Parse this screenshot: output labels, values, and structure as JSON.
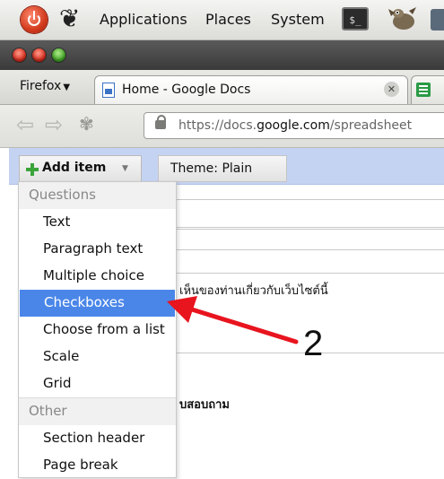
{
  "panel": {
    "menus": [
      "Applications",
      "Places",
      "System"
    ],
    "terminal_text": "$_"
  },
  "browser": {
    "menu_label": "Firefox",
    "tab_title": "Home - Google Docs",
    "url_prefix": "https://docs.",
    "url_domain": "google.com",
    "url_suffix": "/spreadsheet"
  },
  "toolbar": {
    "add_item_label": "Add item",
    "theme_label": "Theme:  Plain"
  },
  "form": {
    "question_text": "เห็นของท่านเกี่ยวกับเว็บไซต์นี้",
    "section_text": "บสอบถาม"
  },
  "menu": {
    "questions_header": "Questions",
    "question_items": [
      "Text",
      "Paragraph text",
      "Multiple choice",
      "Checkboxes",
      "Choose from a list",
      "Scale",
      "Grid"
    ],
    "selected_item": "Checkboxes",
    "other_header": "Other",
    "other_items": [
      "Section header",
      "Page break"
    ]
  },
  "annotation": {
    "number": "2",
    "arrow_color": "#e8141e"
  }
}
